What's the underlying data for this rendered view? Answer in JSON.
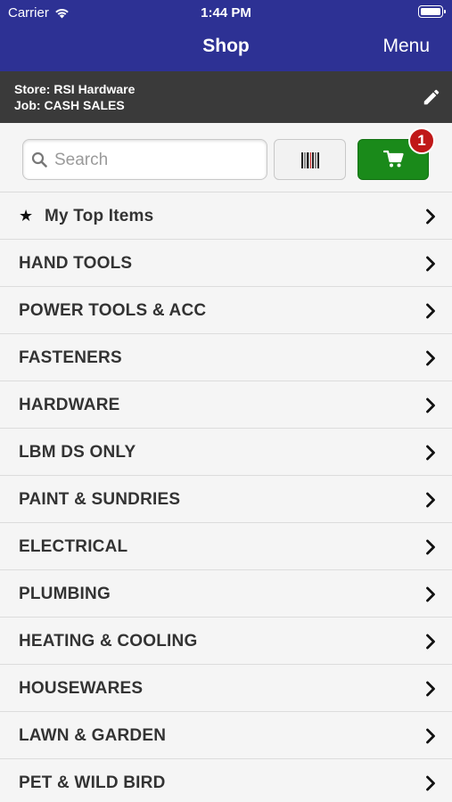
{
  "status_bar": {
    "carrier": "Carrier",
    "time": "1:44 PM"
  },
  "nav": {
    "title": "Shop",
    "menu_label": "Menu"
  },
  "store_info": {
    "store_line": "Store: RSI Hardware",
    "job_line": "Job: CASH SALES"
  },
  "search": {
    "placeholder": "Search",
    "value": ""
  },
  "cart": {
    "count": "1"
  },
  "colors": {
    "nav_bg": "#2d3194",
    "store_bar_bg": "#3a3a3a",
    "cart_green": "#1a8a1a",
    "badge_red": "#c01818"
  },
  "icons": [
    "wifi-icon",
    "battery-icon",
    "pencil-icon",
    "search-icon",
    "barcode-icon",
    "cart-icon",
    "star-icon",
    "chevron-right-icon"
  ],
  "top_items": {
    "label": "My Top Items"
  },
  "categories": [
    {
      "label": "HAND TOOLS"
    },
    {
      "label": "POWER TOOLS & ACC"
    },
    {
      "label": "FASTENERS"
    },
    {
      "label": "HARDWARE"
    },
    {
      "label": "LBM DS ONLY"
    },
    {
      "label": "PAINT & SUNDRIES"
    },
    {
      "label": "ELECTRICAL"
    },
    {
      "label": "PLUMBING"
    },
    {
      "label": "HEATING & COOLING"
    },
    {
      "label": "HOUSEWARES"
    },
    {
      "label": "LAWN & GARDEN"
    },
    {
      "label": "PET & WILD BIRD"
    }
  ]
}
